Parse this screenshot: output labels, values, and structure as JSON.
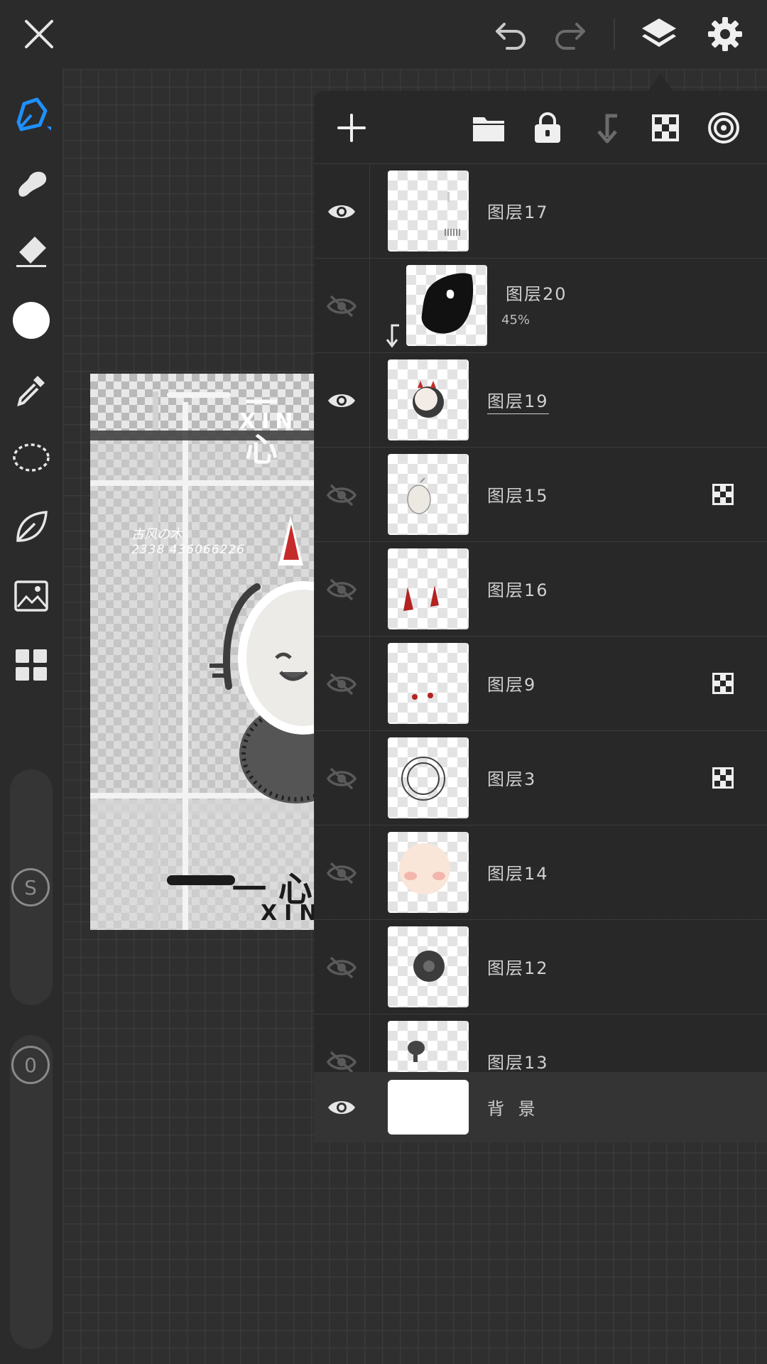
{
  "top_bar": {
    "close_icon": "close-icon",
    "undo_icon": "undo-icon",
    "redo_icon": "redo-icon",
    "layers_icon": "layers-icon",
    "settings_icon": "gear-icon"
  },
  "colors": {
    "accent": "#1e90ff",
    "background": "#2b2b2b",
    "panel": "#282828"
  },
  "toolbar": {
    "tools": [
      "pen-icon",
      "smudge-icon",
      "eraser-icon",
      "color-swatch",
      "eyedropper-icon",
      "lasso-icon",
      "leaf-icon",
      "image-icon",
      "grid-icon"
    ],
    "size_slider_label": "S",
    "opacity_slider_label": "0"
  },
  "artwork": {
    "title_cn": "一 心",
    "title_en": "XIN",
    "caption_line1": "古风の木",
    "caption_line2": "2338 436066226",
    "bottom_cn": "一 心",
    "bottom_en": "XIN"
  },
  "layers_panel": {
    "layers": [
      {
        "name": "图层17",
        "visible": true,
        "alpha_locked": false
      },
      {
        "name": "图层20",
        "visible": false,
        "opacity": "45%",
        "clipped": true
      },
      {
        "name": "图层19",
        "visible": true,
        "selected": true
      },
      {
        "name": "图层15",
        "visible": false,
        "alpha_locked": true
      },
      {
        "name": "图层16",
        "visible": false
      },
      {
        "name": "图层9",
        "visible": false,
        "alpha_locked": true
      },
      {
        "name": "图层3",
        "visible": false,
        "alpha_locked": true
      },
      {
        "name": "图层14",
        "visible": false
      },
      {
        "name": "图层12",
        "visible": false
      },
      {
        "name": "图层13",
        "visible": false
      }
    ],
    "background_layer": {
      "name": "背 景",
      "visible": true
    }
  }
}
